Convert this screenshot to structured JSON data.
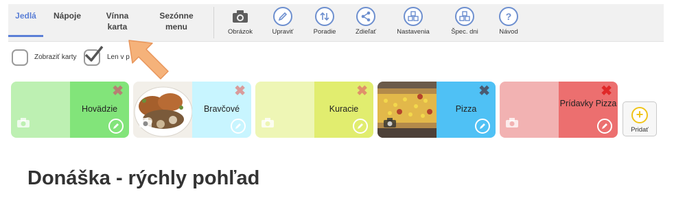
{
  "tabs": [
    {
      "label": "Jedlá",
      "active": true
    },
    {
      "label": "Nápoje"
    },
    {
      "label": "Vínna karta"
    },
    {
      "label": "Sezónne menu"
    }
  ],
  "tools": {
    "image": {
      "label": "Obrázok",
      "icon": "camera-icon"
    },
    "edit": {
      "label": "Upraviť",
      "icon": "pencil-icon"
    },
    "order": {
      "label": "Poradie",
      "icon": "sort-arrows-icon"
    },
    "share": {
      "label": "Zdieľať",
      "icon": "share-icon"
    },
    "settings": {
      "label": "Nastavenia",
      "icon": "grid-icon"
    },
    "special_days": {
      "label": "Špec. dni",
      "icon": "grid-icon"
    },
    "help": {
      "label": "Návod",
      "icon": "question-icon"
    }
  },
  "options": {
    "show_cards": {
      "label": "Zobraziť karty",
      "checked": false
    },
    "only_in": {
      "label": "Len v p",
      "label_end": "e",
      "checked": true
    }
  },
  "categories": [
    {
      "name": "Hovädzie",
      "color": "#82e47a",
      "photo": false
    },
    {
      "name": "Bravčové",
      "color": "#c8f5ff",
      "photo": true
    },
    {
      "name": "Kuracie",
      "color": "#e1ed6f",
      "photo": false
    },
    {
      "name": "Pizza",
      "color": "#4fc1f5",
      "photo": true
    },
    {
      "name": "Prídavky Pizza",
      "color": "#ec6f6f",
      "photo": false
    }
  ],
  "add_button": {
    "label": "Pridať"
  },
  "heading": "Donáška - rýchly pohľad",
  "colors": {
    "accent": "#5b7fd6",
    "icon_ring": "#6d8fcf",
    "add_plus": "#f0c419",
    "arrow": "#f5b27a"
  }
}
